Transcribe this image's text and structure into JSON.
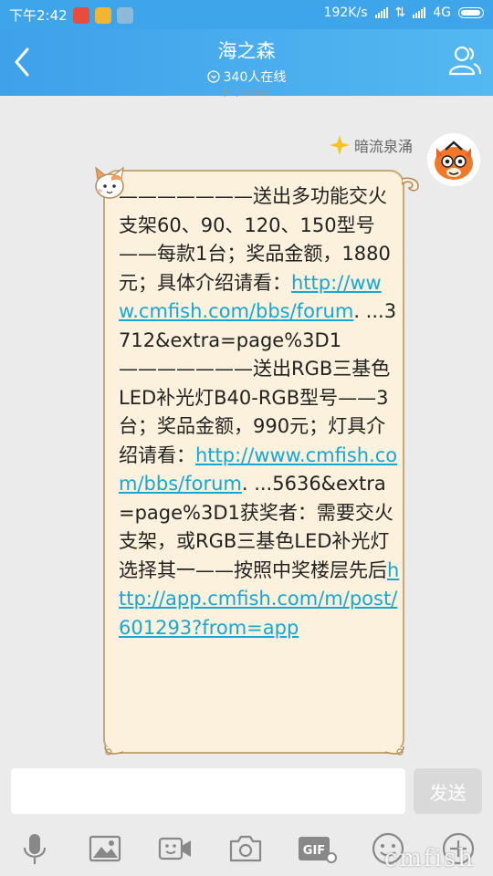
{
  "status_bar": {
    "time": "下午2:42",
    "net_speed": "192K/s",
    "network_type": "4G"
  },
  "header": {
    "title": "海之森",
    "online_count": "340人在线"
  },
  "timestamp_partial": "下午2:42",
  "message": {
    "sender_name": "暗流泉涌",
    "parts": [
      {
        "type": "text",
        "text": "———————送出多功能交火支架60、90、120、150型号——每款1台；奖品金额，1880元；具体介绍请看："
      },
      {
        "type": "link",
        "text": "http://www.cmfish.com/bbs/forum"
      },
      {
        "type": "text",
        "text": ". ...3712&extra=page%3D1———————送出RGB三基色LED补光灯B40-RGB型号——3台；奖品金额，990元；灯具介绍请看："
      },
      {
        "type": "link",
        "text": "http://www.cmfish.com/bbs/forum"
      },
      {
        "type": "text",
        "text": ". ...5636&extra=page%3D1获奖者：需要交火支架，或RGB三基色LED补光灯选择其一——按照中奖楼层先后"
      },
      {
        "type": "link",
        "text": "http://app.cmfish.com/m/post/601293?from=app"
      }
    ]
  },
  "composer": {
    "input_value": "",
    "send_label": "发送"
  },
  "toolbar": {
    "icons": [
      "microphone-icon",
      "image-icon",
      "video-icon",
      "camera-icon",
      "gif-icon",
      "emoji-icon",
      "plus-icon"
    ]
  },
  "watermark": "cmfish",
  "colors": {
    "header_blue": "#3fa5ea",
    "bubble_bg": "#fcf1dc",
    "bubble_border": "#c3a97a",
    "link": "#16a8d4",
    "send_disabled": "#d9d9d9"
  }
}
